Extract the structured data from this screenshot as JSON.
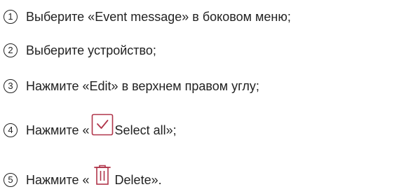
{
  "steps": [
    {
      "number": "1",
      "text": "Выберите «Event message» в боковом меню;"
    },
    {
      "number": "2",
      "text": "Выберите устройство;"
    },
    {
      "number": "3",
      "text": "Нажмите «Edit» в верхнем правом углу;"
    },
    {
      "number": "4",
      "text_before": "Нажмите «",
      "icon": "checkbox-checked-icon",
      "text_after": "Select all»;"
    },
    {
      "number": "5",
      "text_before": "Нажмите «",
      "icon": "trash-icon",
      "text_after": "Delete»."
    }
  ],
  "colors": {
    "text": "#222222",
    "icon_accent": "#b0354a"
  }
}
